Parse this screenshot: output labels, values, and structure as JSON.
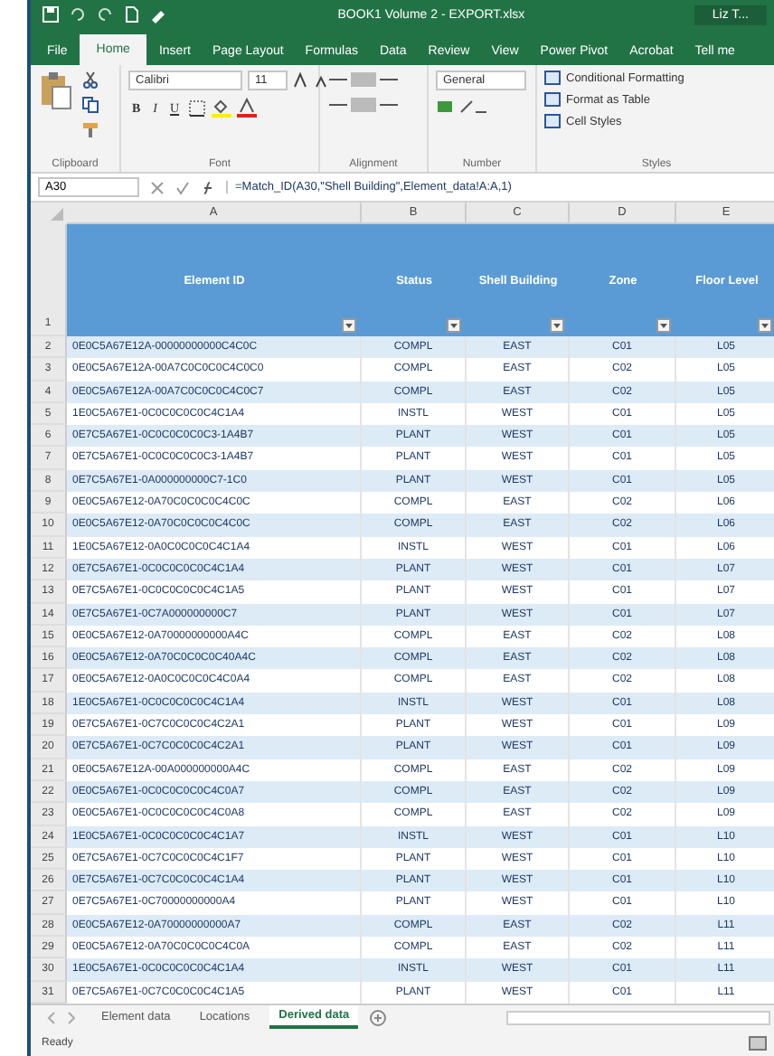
{
  "window": {
    "title": "BOOK1 Volume 2 - EXPORT.xlsx",
    "user": "Liz T..."
  },
  "tabs": [
    {
      "label": "File",
      "selected": false
    },
    {
      "label": "Home",
      "selected": true
    },
    {
      "label": "Insert",
      "selected": false
    },
    {
      "label": "Page Layout",
      "selected": false
    },
    {
      "label": "Formulas",
      "selected": false
    },
    {
      "label": "Data",
      "selected": false
    },
    {
      "label": "Review",
      "selected": false
    },
    {
      "label": "View",
      "selected": false
    },
    {
      "label": "Power Pivot",
      "selected": false
    },
    {
      "label": "Acrobat",
      "selected": false
    },
    {
      "label": "Tell me",
      "selected": false
    }
  ],
  "ribbon": {
    "font_name": "Calibri",
    "font_size": "11",
    "bold": "B",
    "italic": "I",
    "underline": "U",
    "number_format": "General",
    "style_items": [
      "Conditional Formatting",
      "Format as Table",
      "Cell Styles"
    ],
    "groups": [
      "Clipboard",
      "Font",
      "Alignment",
      "Number",
      "Styles"
    ]
  },
  "formula_bar": {
    "name_box": "A30",
    "formula": "=Match_ID(A30,\"Shell Building\",Element_data!A:A,1)"
  },
  "sheet": {
    "header_row_number": "1",
    "column_letters": [
      "A",
      "B",
      "C",
      "D",
      "E"
    ],
    "headers": [
      "Element ID",
      "Status",
      "Shell Building",
      "Zone",
      "Floor Level"
    ],
    "rows": [
      {
        "n": "2",
        "id": "0E0C5A67E12A-00000000000C4C0C",
        "status": "COMPL",
        "building": "EAST",
        "zone": "C01",
        "level": "L05"
      },
      {
        "n": "3",
        "id": "0E0C5A67E12A-00A7C0C0C0C4C0C0",
        "status": "COMPL",
        "building": "EAST",
        "zone": "C02",
        "level": "L05"
      },
      {
        "n": "4",
        "id": "0E0C5A67E12A-00A7C0C0C0C4C0C7",
        "status": "COMPL",
        "building": "EAST",
        "zone": "C02",
        "level": "L05"
      },
      {
        "n": "5",
        "id": "1E0C5A67E1-0C0C0C0C0C4C1A4",
        "status": "INSTL",
        "building": "WEST",
        "zone": "C01",
        "level": "L05"
      },
      {
        "n": "6",
        "id": "0E7C5A67E1-0C0C0C0C0C3-1A4B7",
        "status": "PLANT",
        "building": "WEST",
        "zone": "C01",
        "level": "L05"
      },
      {
        "n": "7",
        "id": "0E7C5A67E1-0C0C0C0C0C3-1A4B7",
        "status": "PLANT",
        "building": "WEST",
        "zone": "C01",
        "level": "L05"
      },
      {
        "n": "8",
        "id": "0E7C5A67E1-0A000000000C7-1C0",
        "status": "PLANT",
        "building": "WEST",
        "zone": "C01",
        "level": "L05"
      },
      {
        "n": "9",
        "id": "0E0C5A67E12-0A70C0C0C0C4C0C",
        "status": "COMPL",
        "building": "EAST",
        "zone": "C02",
        "level": "L06"
      },
      {
        "n": "10",
        "id": "0E0C5A67E12-0A70C0C0C0C4C0C",
        "status": "COMPL",
        "building": "EAST",
        "zone": "C02",
        "level": "L06"
      },
      {
        "n": "11",
        "id": "1E0C5A67E12-0A0C0C0C0C4C1A4",
        "status": "INSTL",
        "building": "WEST",
        "zone": "C01",
        "level": "L06"
      },
      {
        "n": "12",
        "id": "0E7C5A67E1-0C0C0C0C0C4C1A4",
        "status": "PLANT",
        "building": "WEST",
        "zone": "C01",
        "level": "L07"
      },
      {
        "n": "13",
        "id": "0E7C5A67E1-0C0C0C0C0C4C1A5",
        "status": "PLANT",
        "building": "WEST",
        "zone": "C01",
        "level": "L07"
      },
      {
        "n": "14",
        "id": "0E7C5A67E1-0C7A000000000C7",
        "status": "PLANT",
        "building": "WEST",
        "zone": "C01",
        "level": "L07"
      },
      {
        "n": "15",
        "id": "0E0C5A67E12-0A70000000000A4C",
        "status": "COMPL",
        "building": "EAST",
        "zone": "C02",
        "level": "L08"
      },
      {
        "n": "16",
        "id": "0E0C5A67E12-0A70C0C0C0C40A4C",
        "status": "COMPL",
        "building": "EAST",
        "zone": "C02",
        "level": "L08"
      },
      {
        "n": "17",
        "id": "0E0C5A67E12-0A0C0C0C0C4C0A4",
        "status": "COMPL",
        "building": "EAST",
        "zone": "C02",
        "level": "L08"
      },
      {
        "n": "18",
        "id": "1E0C5A67E1-0C0C0C0C0C4C1A4",
        "status": "INSTL",
        "building": "WEST",
        "zone": "C01",
        "level": "L08"
      },
      {
        "n": "19",
        "id": "0E7C5A67E1-0C7C0C0C0C4C2A1",
        "status": "PLANT",
        "building": "WEST",
        "zone": "C01",
        "level": "L09"
      },
      {
        "n": "20",
        "id": "0E7C5A67E1-0C7C0C0C0C4C2A1",
        "status": "PLANT",
        "building": "WEST",
        "zone": "C01",
        "level": "L09"
      },
      {
        "n": "21",
        "id": "0E0C5A67E12A-00A000000000A4C",
        "status": "COMPL",
        "building": "EAST",
        "zone": "C02",
        "level": "L09"
      },
      {
        "n": "22",
        "id": "0E0C5A67E1-0C0C0C0C0C4C0A7",
        "status": "COMPL",
        "building": "EAST",
        "zone": "C02",
        "level": "L09"
      },
      {
        "n": "23",
        "id": "0E0C5A67E1-0C0C0C0C0C4C0A8",
        "status": "COMPL",
        "building": "EAST",
        "zone": "C02",
        "level": "L09"
      },
      {
        "n": "24",
        "id": "1E0C5A67E1-0C0C0C0C0C4C1A7",
        "status": "INSTL",
        "building": "WEST",
        "zone": "C01",
        "level": "L10"
      },
      {
        "n": "25",
        "id": "0E7C5A67E1-0C7C0C0C0C4C1F7",
        "status": "PLANT",
        "building": "WEST",
        "zone": "C01",
        "level": "L10"
      },
      {
        "n": "26",
        "id": "0E7C5A67E1-0C7C0C0C0C4C1A4",
        "status": "PLANT",
        "building": "WEST",
        "zone": "C01",
        "level": "L10"
      },
      {
        "n": "27",
        "id": "0E7C5A67E1-0C70000000000A4",
        "status": "PLANT",
        "building": "WEST",
        "zone": "C01",
        "level": "L10"
      },
      {
        "n": "28",
        "id": "0E0C5A67E12-0A70000000000A7",
        "status": "COMPL",
        "building": "EAST",
        "zone": "C02",
        "level": "L11"
      },
      {
        "n": "29",
        "id": "0E0C5A67E12-0A70C0C0C0C4C0A",
        "status": "COMPL",
        "building": "EAST",
        "zone": "C02",
        "level": "L11"
      },
      {
        "n": "30",
        "id": "1E0C5A67E1-0C0C0C0C0C4C1A4",
        "status": "INSTL",
        "building": "WEST",
        "zone": "C01",
        "level": "L11"
      },
      {
        "n": "31",
        "id": "0E7C5A67E1-0C7C0C0C0C4C1A5",
        "status": "PLANT",
        "building": "WEST",
        "zone": "C01",
        "level": "L11"
      }
    ]
  },
  "sheet_tabs": [
    {
      "label": "Element data",
      "selected": false
    },
    {
      "label": "Locations",
      "selected": false
    },
    {
      "label": "Derived data",
      "selected": true
    }
  ],
  "status_bar": {
    "text": "Ready"
  }
}
